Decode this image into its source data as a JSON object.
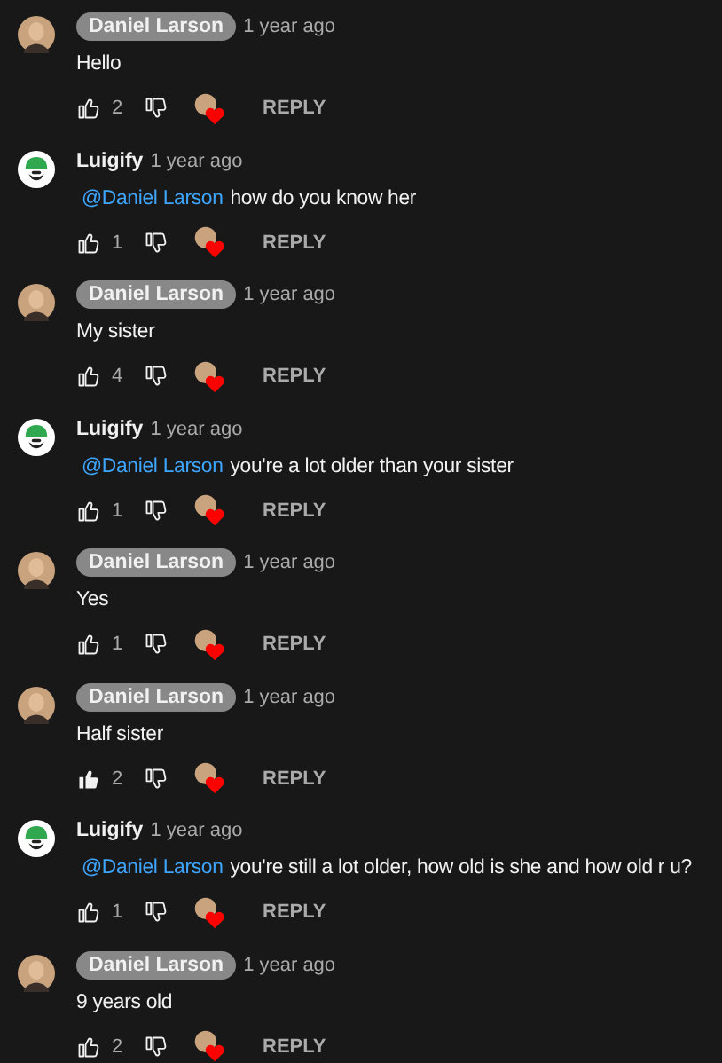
{
  "comments": [
    {
      "kind": "photo",
      "author": "Daniel Larson",
      "author_badge": true,
      "time": "1 year ago",
      "text": "Hello",
      "likes": "2",
      "liked": false,
      "hearted": true,
      "reply": "REPLY"
    },
    {
      "kind": "logo",
      "author": "Luigify",
      "author_badge": false,
      "time": "1 year ago",
      "mention": "@Daniel Larson",
      "text": "how do you know her",
      "likes": "1",
      "liked": false,
      "hearted": true,
      "reply": "REPLY"
    },
    {
      "kind": "photo",
      "author": "Daniel Larson",
      "author_badge": true,
      "time": "1 year ago",
      "text": "My sister",
      "likes": "4",
      "liked": false,
      "hearted": true,
      "reply": "REPLY"
    },
    {
      "kind": "logo",
      "author": "Luigify",
      "author_badge": false,
      "time": "1 year ago",
      "mention": "@Daniel Larson",
      "text": "you're a lot older than your sister",
      "likes": "1",
      "liked": false,
      "hearted": true,
      "reply": "REPLY"
    },
    {
      "kind": "photo",
      "author": "Daniel Larson",
      "author_badge": true,
      "time": "1 year ago",
      "text": "Yes",
      "likes": "1",
      "liked": false,
      "hearted": true,
      "reply": "REPLY"
    },
    {
      "kind": "photo",
      "author": "Daniel Larson",
      "author_badge": true,
      "time": "1 year ago",
      "text": "Half sister",
      "likes": "2",
      "liked": true,
      "hearted": true,
      "reply": "REPLY"
    },
    {
      "kind": "logo",
      "author": "Luigify",
      "author_badge": false,
      "time": "1 year ago",
      "mention": "@Daniel Larson",
      "text": "you're still a lot older, how old is she and how old r u?",
      "likes": "1",
      "liked": false,
      "hearted": true,
      "reply": "REPLY"
    },
    {
      "kind": "photo",
      "author": "Daniel Larson",
      "author_badge": true,
      "time": "1 year ago",
      "text": "9 years old",
      "likes": "2",
      "liked": false,
      "hearted": true,
      "reply": "REPLY"
    }
  ]
}
